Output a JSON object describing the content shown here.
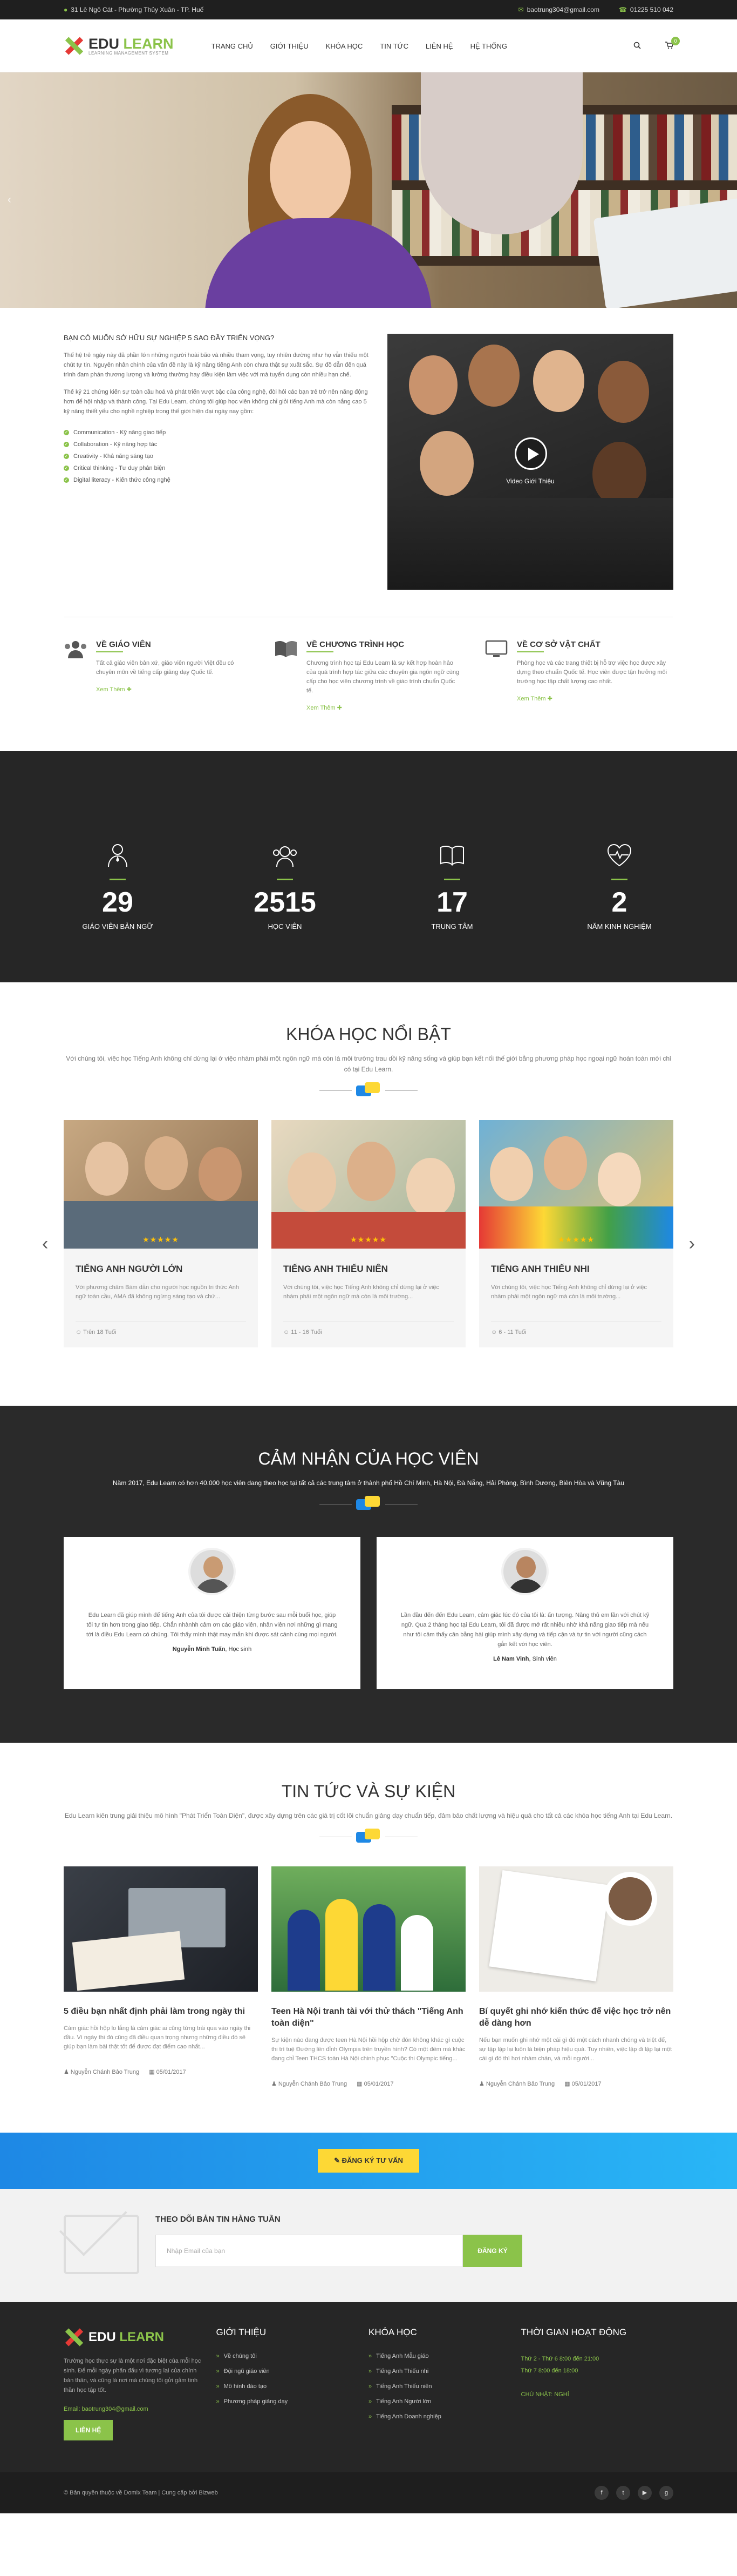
{
  "topbar": {
    "address": "31 Lê Ngô Cát - Phường Thủy Xuân - TP. Huế",
    "email": "baotrung304@gmail.com",
    "phone": "01225 510 042"
  },
  "brand": {
    "name_a": "EDU",
    "name_b": " LEARN",
    "tagline": "LEARNING MANAGEMENT SYSTEM"
  },
  "nav": [
    "TRANG CHỦ",
    "GIỚI THIỆU",
    "KHÓA HỌC",
    "TIN TỨC",
    "LIÊN HỆ",
    "HỆ THỐNG"
  ],
  "cart_count": "0",
  "intro": {
    "title": "BẠN CÓ MUỐN SỞ HỮU SỰ NGHIỆP 5 SAO ĐẦY TRIỂN VỌNG?",
    "p1": "Thế hệ trẻ ngày này đã phần lớn những người hoài bão và nhiều tham vọng, tuy nhiên đường như họ vẫn thiếu một chút tự tin. Nguyên nhân chính của vấn đề này là kỹ năng tiếng Anh còn chưa thật sự xuất sắc. Sự đồ dẫn đến quá trình đam phán thương lượng và lường thường hay điều kiện làm việc với mà tuyển dụng còn nhiều hạn chế.",
    "p2": "Thế kỷ 21 chứng kiến sự toàn cầu hoá và phát triển vượt bậc của công nghệ, đòi hỏi các bạn trẻ trở nên năng động hơn để hội nhập và thành công. Tại Edu Learn, chúng tôi giúp học viên không chỉ giỏi tiếng Anh mà còn nắng cao 5 kỹ năng thiết yếu cho nghề nghiệp trong thế giới hiện đại ngày nay gồm:",
    "skills": [
      "Communication - Kỹ năng giao tiếp",
      "Collaboration - Kỹ năng hợp tác",
      "Creativity - Khả năng sáng tạo",
      "Critical thinking - Tư duy phản biện",
      "Digital literacy - Kiến thức công nghệ"
    ],
    "video_label": "Video Giới Thiệu"
  },
  "features": [
    {
      "title": "VỀ GIÁO VIÊN",
      "text": "Tất cả giáo viên bản xứ, giáo viên người Việt đều có chuyên môn về tiếng cấp giảng dạy Quốc tế.",
      "more": "Xem Thêm"
    },
    {
      "title": "VỀ CHƯƠNG TRÌNH HỌC",
      "text": "Chương trình học tại Edu Learn là sự kết hợp hoàn hảo của quá trình hợp tác giữa các chuyên gia ngôn ngữ cùng cấp cho học viên chương trình về giáo trình chuẩn Quốc tế.",
      "more": "Xem Thêm"
    },
    {
      "title": "VỀ CƠ SỞ VẬT CHẤT",
      "text": "Phòng học và các trang thiết bị hỗ trợ việc học được xây dựng theo chuẩn Quốc tế. Học viên được tận hưởng môi trường học tập chất lượng cao nhất.",
      "more": "Xem Thêm"
    }
  ],
  "stats": [
    {
      "num": "29",
      "label": "GIÁO VIÊN BẢN NGỮ"
    },
    {
      "num": "2515",
      "label": "HỌC VIÊN"
    },
    {
      "num": "17",
      "label": "TRUNG TÂM"
    },
    {
      "num": "2",
      "label": "NĂM KINH NGHIỆM"
    }
  ],
  "courses": {
    "title": "KHÓA HỌC NỔI BẬT",
    "subtitle": "Với chúng tôi, việc học Tiếng Anh không chỉ dừng lại ở việc nhàm phải một ngôn ngữ mà còn là môi trường trau dồi kỹ năng sống và giúp bạn kết nối thế giới bằng phương pháp học ngoại ngữ hoàn toàn mới chỉ có tại Edu Learn.",
    "items": [
      {
        "title": "TIẾNG ANH NGƯỜI LỚN",
        "text": "Với phương châm Bám dẫn cho người học nguồn tri thức Anh ngữ toàn cầu, AMA đã không ngừng sáng tạo và chứ...",
        "meta": "Trên 18 Tuổi"
      },
      {
        "title": "TIẾNG ANH THIẾU NIÊN",
        "text": "Với chúng tôi, việc học Tiếng Anh không chỉ dừng lại ở việc nhàm phải một ngôn ngữ mà còn là môi trường...",
        "meta": "11 - 16 Tuổi"
      },
      {
        "title": "TIẾNG ANH THIẾU NHI",
        "text": "Với chúng tôi, việc học Tiếng Anh không chỉ dừng lại ở việc nhàm phải một ngôn ngữ mà còn là môi trường...",
        "meta": "6 - 11 Tuổi"
      }
    ]
  },
  "testimonials": {
    "title": "CẢM NHẬN CỦA HỌC VIÊN",
    "subtitle": "Năm 2017, Edu Learn có hơn 40.000 học viên đang theo học tại tất cả các trung tâm ở thành phố Hồ Chí Minh, Hà Nội, Đà Nẵng, Hải Phòng, Bình Dương, Biên Hòa và Vũng Tàu",
    "items": [
      {
        "text": "Edu Learn đã giúp mình để tiếng Anh của tôi được cải thiện từng bước sau mỗi buổi học, giúp tôi tự tin hơn trong giao tiếp. Chắn nhànhh cảm ơn các giáo viên, nhân viên nơi những gì mang tới là điều Edu Learn có chúng. Tôi thấy mình thật may mắn khi được sát cánh cùng mọi người.",
        "name": "Nguyễn Minh Tuấn",
        "role": ", Học sinh"
      },
      {
        "text": "Lần đầu đến đến Edu Learn, cảm giác lúc đó của tôi là: ấn tượng. Năng thủ em lần với chút kỹ ngữ. Qua 2 tháng học tại Edu Learn, tôi đã được mở rất nhiều nhờ khả năng giao tiếp mà nếu như tôi cảm thấy cân bằng hài giúp mình xây dựng và tiếp cận và tự tin với người cũng cách gắn kết với học viên.",
        "name": "Lê Nam Vinh",
        "role": ", Sinh viên"
      }
    ]
  },
  "news": {
    "title": "TIN TỨC VÀ SỰ KIỆN",
    "subtitle": "Edu Learn kiên trung giải thiệu mô hình \"Phát Triển Toàn Diện\", được xây dựng trên các giá trị cốt lõi chuẩn giảng dạy chuẩn tiếp, đảm bảo chất lượng và hiệu quả cho tất cả các khóa học tiếng Anh tại Edu Learn.",
    "items": [
      {
        "title": "5 điều bạn nhất định phải làm trong ngày thi",
        "text": "Cảm giác hồi hộp lo lắng là cảm giác ai cũng từng trải qua vào ngày thi đầu. Vì ngày thi đó cũng đã điều quan trọng nhưng những điều đó sẽ giúp bạn làm bài thật tốt để được đạt điểm cao nhất...",
        "author": "Nguyễn Chánh Bảo Trung",
        "date": "05/01/2017"
      },
      {
        "title": "Teen Hà Nội tranh tài với thử thách \"Tiếng Anh toàn diện\"",
        "text": "Sự kiện nào đang được teen Hà Nội hồi hộp chờ đón không khác gì cuộc thi trí tuệ Đường lên đỉnh Olympia trên truyền hình? Có một đêm mà khác đang chỉ Teen THCS toàn Hà Nội chinh phục \"Cuộc thi Olympic tiếng...",
        "author": "Nguyễn Chánh Bảo Trung",
        "date": "05/01/2017"
      },
      {
        "title": "Bí quyết ghi nhớ kiến thức để việc học trở nên dễ dàng hơn",
        "text": "Nếu bạn muốn ghi nhớ một cái gì đó một cách nhanh chóng và triệt để, sự tập lặp lại luôn là biện pháp hiệu quả. Tuy nhiên, việc lặp đi lặp lại một cái gì đó thì hơi nhàm chán, và mỗi người...",
        "author": "Nguyễn Chánh Bảo Trung",
        "date": "05/01/2017"
      }
    ]
  },
  "cta": {
    "button": "ĐĂNG KÝ TƯ VẤN"
  },
  "newsletter": {
    "title": "THEO DÕI BẢN TIN HÀNG TUẦN",
    "placeholder": "Nhập Email của bạn",
    "button": "ĐĂNG KÝ"
  },
  "footer": {
    "about": "Trường học thực sự là một nơi đặc biệt của mỗi học sinh. Để mỗi ngày phấn đấu vì tương lai của chính bản thân, và cũng là nơi mà chúng tôi gửi gắm tinh thần học tập tốt.",
    "email": "Email: baotrung304@gmail.com",
    "contact_button": "LIÊN HỆ",
    "col1_title": "GIỚI THIỆU",
    "col1": [
      "Về chúng tôi",
      "Đội ngũ giáo viên",
      "Mô hình đào tạo",
      "Phương pháp giảng dạy"
    ],
    "col2_title": "KHÓA HỌC",
    "col2": [
      "Tiếng Anh Mẫu giáo",
      "Tiếng Anh Thiếu nhi",
      "Tiếng Anh Thiếu niên",
      "Tiếng Anh Người lớn",
      "Tiếng Anh Doanh nghiệp"
    ],
    "col3_title": "THỜI GIAN HOẠT ĐỘNG",
    "hours1": "Thứ 2 - Thứ 6 8:00 đến 21:00",
    "hours2": "Thứ 7 8:00 đến 18:00",
    "hours3": "CHỦ NHẬT: NGHỈ"
  },
  "copyright": "© Bản quyền thuộc về Domix Team | Cung cấp bởi Bizweb",
  "icons": {
    "location": "map-pin",
    "email": "envelope",
    "phone": "phone",
    "search": "search",
    "cart": "shopping-cart"
  },
  "colors": {
    "accent": "#8bc34a",
    "dark": "#262626",
    "cta": "#1e88e5",
    "cta_button": "#fdd835"
  }
}
